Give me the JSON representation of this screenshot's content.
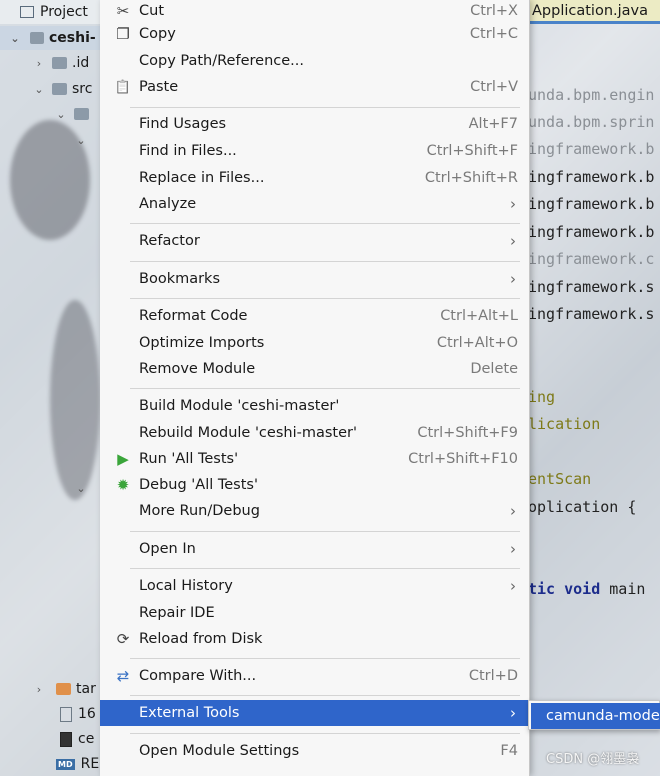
{
  "project_panel": {
    "tab_label": "Project",
    "root_label": "ceshi-",
    "rows": [
      ".id",
      "src",
      "tar",
      "16",
      "ce",
      "RE"
    ]
  },
  "editor": {
    "tab_label": "Application.java",
    "lines": [
      {
        "text": "unda.bpm.engin",
        "style": "gray"
      },
      {
        "text": "unda.bpm.sprin",
        "style": "gray"
      },
      {
        "text": "ingframework.b",
        "style": "gray"
      },
      {
        "text": "ingframework.b",
        "style": "normal"
      },
      {
        "text": "ingframework.b",
        "style": "normal"
      },
      {
        "text": "ingframework.b",
        "style": "normal"
      },
      {
        "text": "ingframework.c",
        "style": "gray"
      },
      {
        "text": "ingframework.s",
        "style": "normal"
      },
      {
        "text": "ingframework.s",
        "style": "normal"
      },
      {
        "text": "ing",
        "style": "olive"
      },
      {
        "text": "lication",
        "style": "olive"
      },
      {
        "text": "entScan",
        "style": "olive"
      },
      {
        "text": "oplication {",
        "style": "normal"
      },
      {
        "text_kw": "tic void",
        "text": " main",
        "style": "kw"
      }
    ]
  },
  "menu": {
    "items": [
      {
        "label": "Cut",
        "shortcut": "Ctrl+X",
        "icon": "scissors-icon",
        "glyph": "✂"
      },
      {
        "label": "Copy",
        "shortcut": "Ctrl+C",
        "icon": "copy-icon",
        "glyph": "❐"
      },
      {
        "label": "Copy Path/Reference...",
        "shortcut": ""
      },
      {
        "label": "Paste",
        "shortcut": "Ctrl+V",
        "icon": "clipboard-icon",
        "glyph": "📋"
      },
      {
        "label": "Find Usages",
        "shortcut": "Alt+F7"
      },
      {
        "label": "Find in Files...",
        "shortcut": "Ctrl+Shift+F"
      },
      {
        "label": "Replace in Files...",
        "shortcut": "Ctrl+Shift+R"
      },
      {
        "label": "Analyze",
        "shortcut": "",
        "submenu": true
      },
      {
        "label": "Refactor",
        "shortcut": "",
        "submenu": true
      },
      {
        "label": "Bookmarks",
        "shortcut": "",
        "submenu": true
      },
      {
        "label": "Reformat Code",
        "shortcut": "Ctrl+Alt+L"
      },
      {
        "label": "Optimize Imports",
        "shortcut": "Ctrl+Alt+O"
      },
      {
        "label": "Remove Module",
        "shortcut": "Delete"
      },
      {
        "label": "Build Module 'ceshi-master'",
        "shortcut": ""
      },
      {
        "label": "Rebuild Module 'ceshi-master'",
        "shortcut": "Ctrl+Shift+F9"
      },
      {
        "label": "Run 'All Tests'",
        "shortcut": "Ctrl+Shift+F10",
        "icon": "run-icon",
        "glyph": "▶"
      },
      {
        "label": "Debug 'All Tests'",
        "shortcut": "",
        "icon": "debug-bug-icon",
        "glyph": "✹"
      },
      {
        "label": "More Run/Debug",
        "shortcut": "",
        "submenu": true
      },
      {
        "label": "Open In",
        "shortcut": "",
        "submenu": true
      },
      {
        "label": "Local History",
        "shortcut": "",
        "submenu": true
      },
      {
        "label": "Repair IDE",
        "shortcut": ""
      },
      {
        "label": "Reload from Disk",
        "shortcut": "",
        "icon": "reload-icon",
        "glyph": "⟳"
      },
      {
        "label": "Compare With...",
        "shortcut": "Ctrl+D",
        "icon": "compare-icon",
        "glyph": "⇄"
      },
      {
        "label": "External Tools",
        "shortcut": "",
        "submenu": true,
        "selected": true
      },
      {
        "label": "Open Module Settings",
        "shortcut": "F4"
      }
    ],
    "submenu_chevron": "›"
  },
  "submenu": {
    "item_label": "camunda-mode"
  },
  "watermark": "CSDN @翎墨袅",
  "colors": {
    "selection": "#2f65ca",
    "run_icon": "#3aa53a",
    "debug_icon": "#3aa53a",
    "compare_icon": "#3b73c4"
  }
}
